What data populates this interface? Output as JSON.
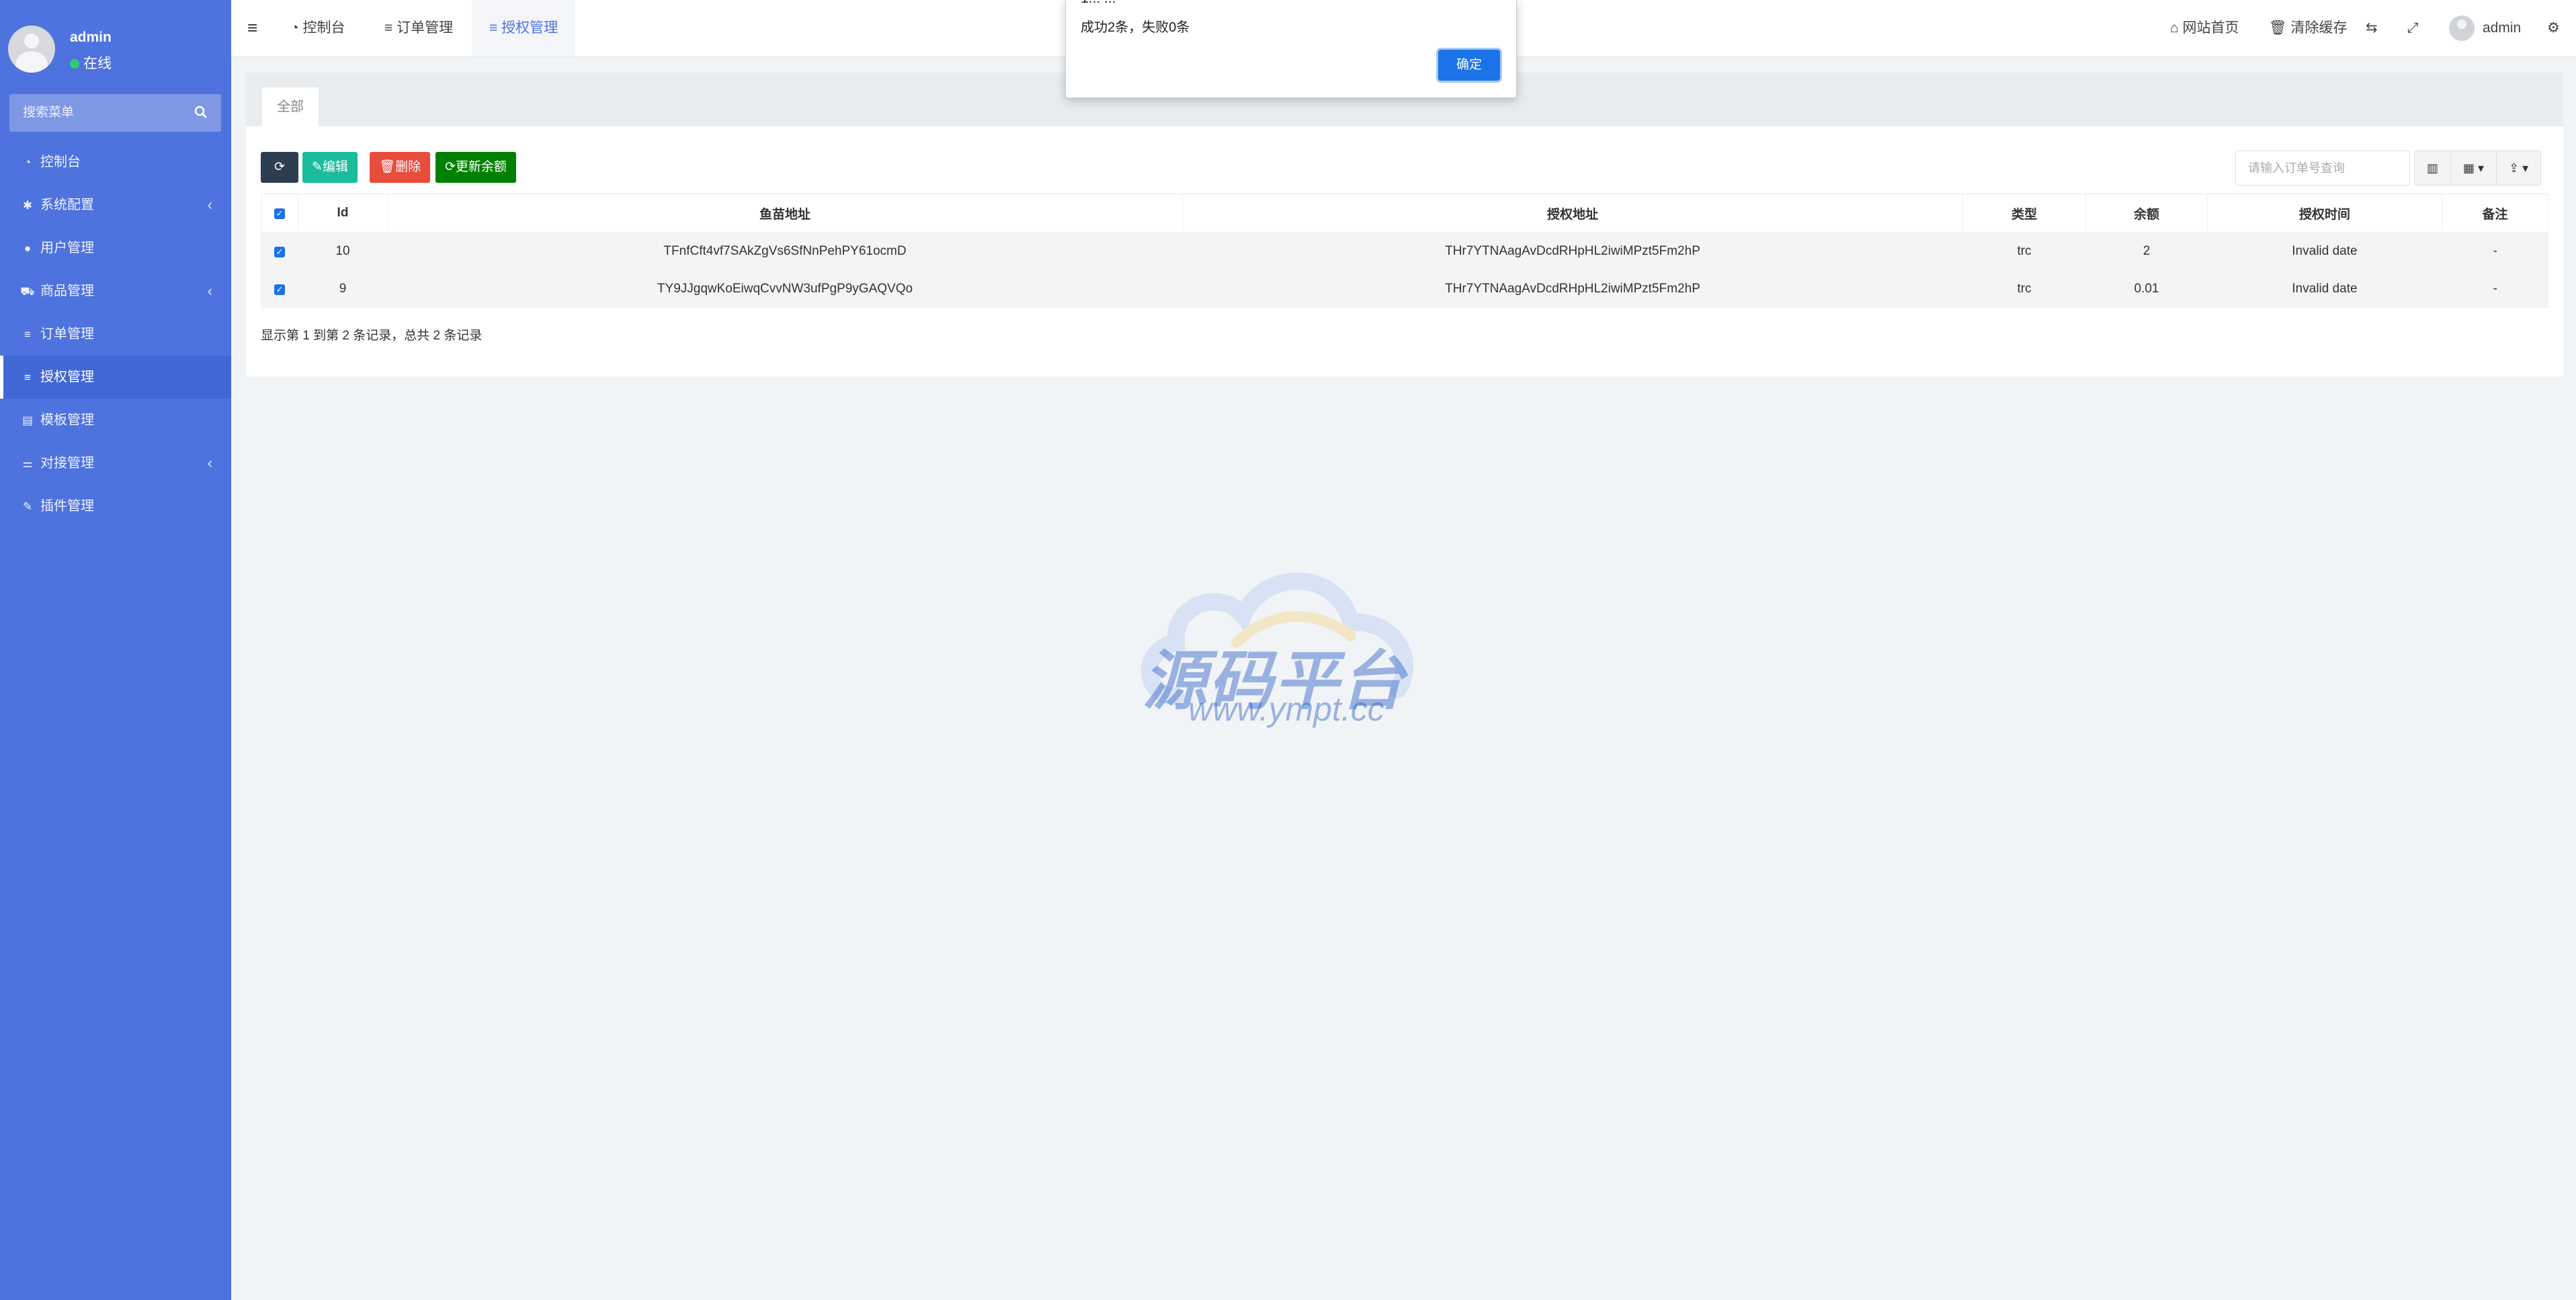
{
  "sidebar": {
    "user": {
      "name": "admin",
      "status": "在线"
    },
    "search_placeholder": "搜索菜单",
    "items": [
      {
        "label": "控制台",
        "icon": "dashboard-icon"
      },
      {
        "label": "系统配置",
        "icon": "gear-icon",
        "has_children": true
      },
      {
        "label": "用户管理",
        "icon": "user-icon"
      },
      {
        "label": "商品管理",
        "icon": "cart-icon",
        "has_children": true
      },
      {
        "label": "订单管理",
        "icon": "list-icon"
      },
      {
        "label": "授权管理",
        "icon": "list-icon",
        "active": true
      },
      {
        "label": "模板管理",
        "icon": "template-icon"
      },
      {
        "label": "对接管理",
        "icon": "sliders-icon",
        "has_children": true
      },
      {
        "label": "插件管理",
        "icon": "plug-icon"
      }
    ]
  },
  "header": {
    "tabs": [
      {
        "label": "控制台",
        "icon": "dashboard-icon"
      },
      {
        "label": "订单管理",
        "icon": "list-icon"
      },
      {
        "label": "授权管理",
        "icon": "list-icon",
        "active": true
      }
    ],
    "right": {
      "home": "网站首页",
      "clear_cache": "清除缓存",
      "user": "admin"
    }
  },
  "dialog": {
    "title": "1... ...",
    "message": "成功2条，失败0条",
    "ok_label": "确定"
  },
  "content": {
    "tab": "全部",
    "toolbar": {
      "edit": "编辑",
      "delete": "删除",
      "update_balance": "更新余额",
      "search_placeholder": "请输入订单号查询"
    },
    "table": {
      "columns": [
        "Id",
        "鱼苗地址",
        "授权地址",
        "类型",
        "余额",
        "授权时间",
        "备注"
      ],
      "rows": [
        {
          "id": "10",
          "fish": "TFnfCft4vf7SAkZgVs6SfNnPehPY61ocmD",
          "auth": "THr7YTNAagAvDcdRHpHL2iwiMPzt5Fm2hP",
          "type": "trc",
          "balance": "2",
          "time": "Invalid date",
          "note": "-"
        },
        {
          "id": "9",
          "fish": "TY9JJgqwKoEiwqCvvNW3ufPgP9yGAQVQo",
          "auth": "THr7YTNAagAvDcdRHpHL2iwiMPzt5Fm2hP",
          "type": "trc",
          "balance": "0.01",
          "time": "Invalid date",
          "note": "-"
        }
      ]
    },
    "pager_info": "显示第 1 到第 2 条记录，总共 2 条记录"
  },
  "watermark": {
    "text": "源码平台",
    "url": "www.ympt.cc"
  },
  "colors": {
    "sidebar": "#4e73df",
    "primary": "#1a73e8",
    "success": "#1abc9c",
    "danger": "#e74c3c",
    "green": "#008000",
    "dark": "#2c3e50"
  }
}
